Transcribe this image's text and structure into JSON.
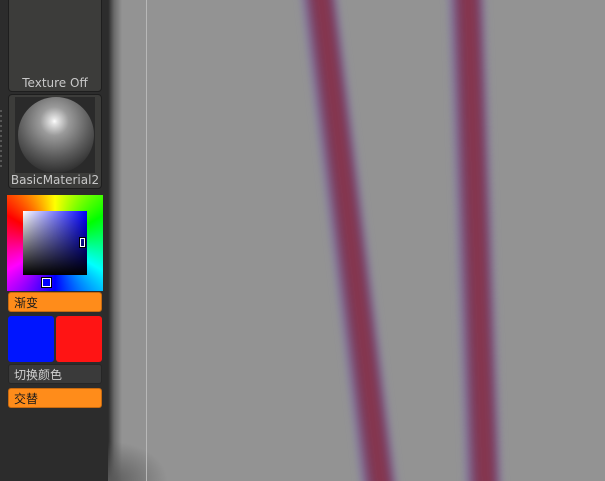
{
  "panel": {
    "texture_slot_label": "Texture Off",
    "material_slot_label": "BasicMaterial2",
    "gradient_button_label": "渐变",
    "swap_color_button_label": "切换颜色",
    "alternate_button_label": "交替"
  },
  "colors": {
    "main_color": "#0015ff",
    "secondary_color": "#ff1414",
    "active_button": "#ff8c1a",
    "canvas_background": "#939393",
    "stroke_color": "#8a3448"
  },
  "canvas": {
    "stroke_count": 2
  }
}
